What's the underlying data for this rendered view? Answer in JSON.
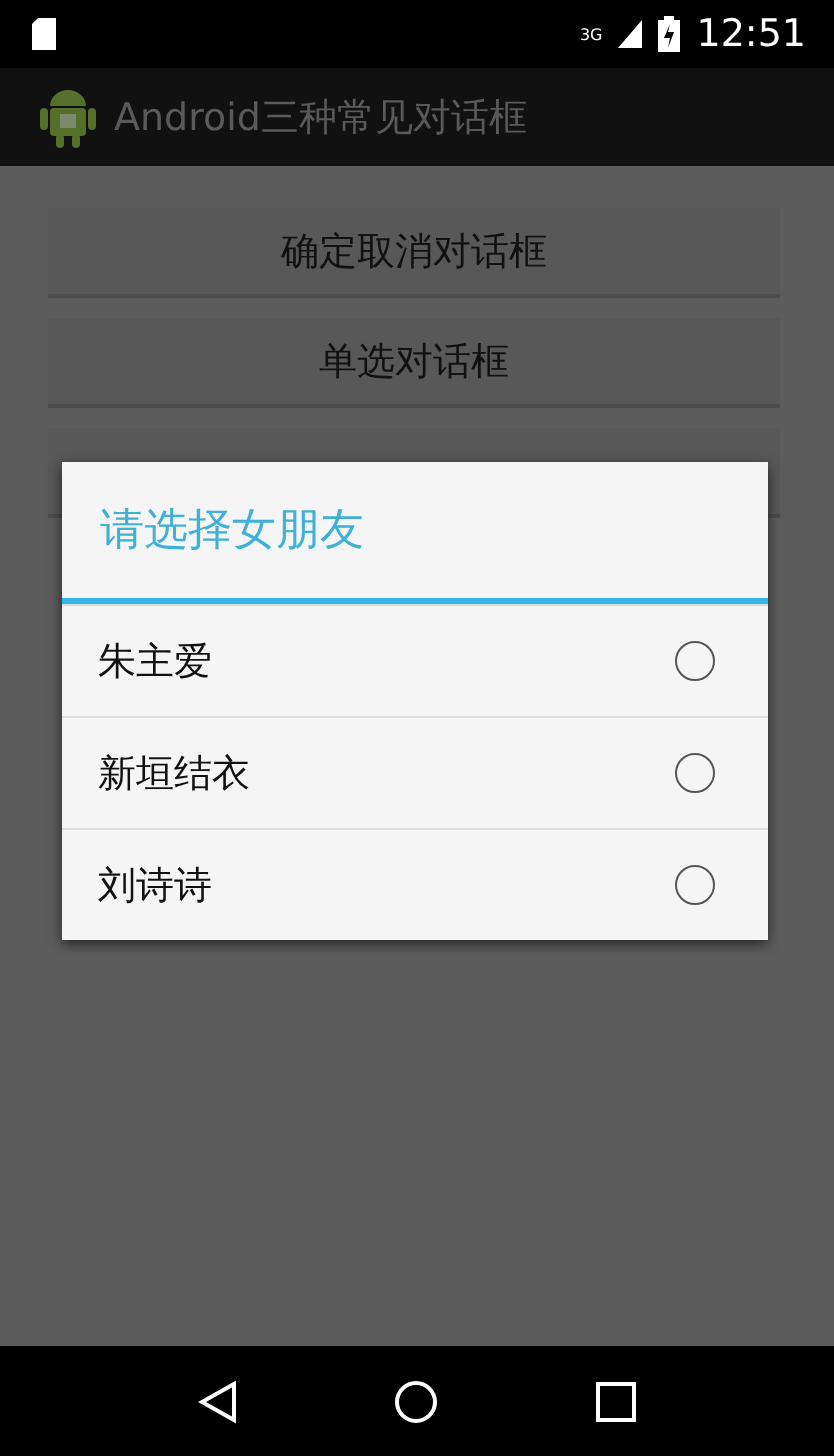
{
  "status_bar": {
    "time": "12:51",
    "network": "3G"
  },
  "action_bar": {
    "title": "Android三种常见对话框"
  },
  "buttons": [
    {
      "kind": "labeled",
      "label": "确定取消对话框"
    },
    {
      "kind": "labeled",
      "label": "单选对话框"
    },
    {
      "kind": "covered"
    }
  ],
  "dialog": {
    "title": "请选择女朋友",
    "options": [
      {
        "label": "朱主爱",
        "selected": false
      },
      {
        "label": "新垣结衣",
        "selected": false
      },
      {
        "label": "刘诗诗",
        "selected": false
      }
    ]
  }
}
